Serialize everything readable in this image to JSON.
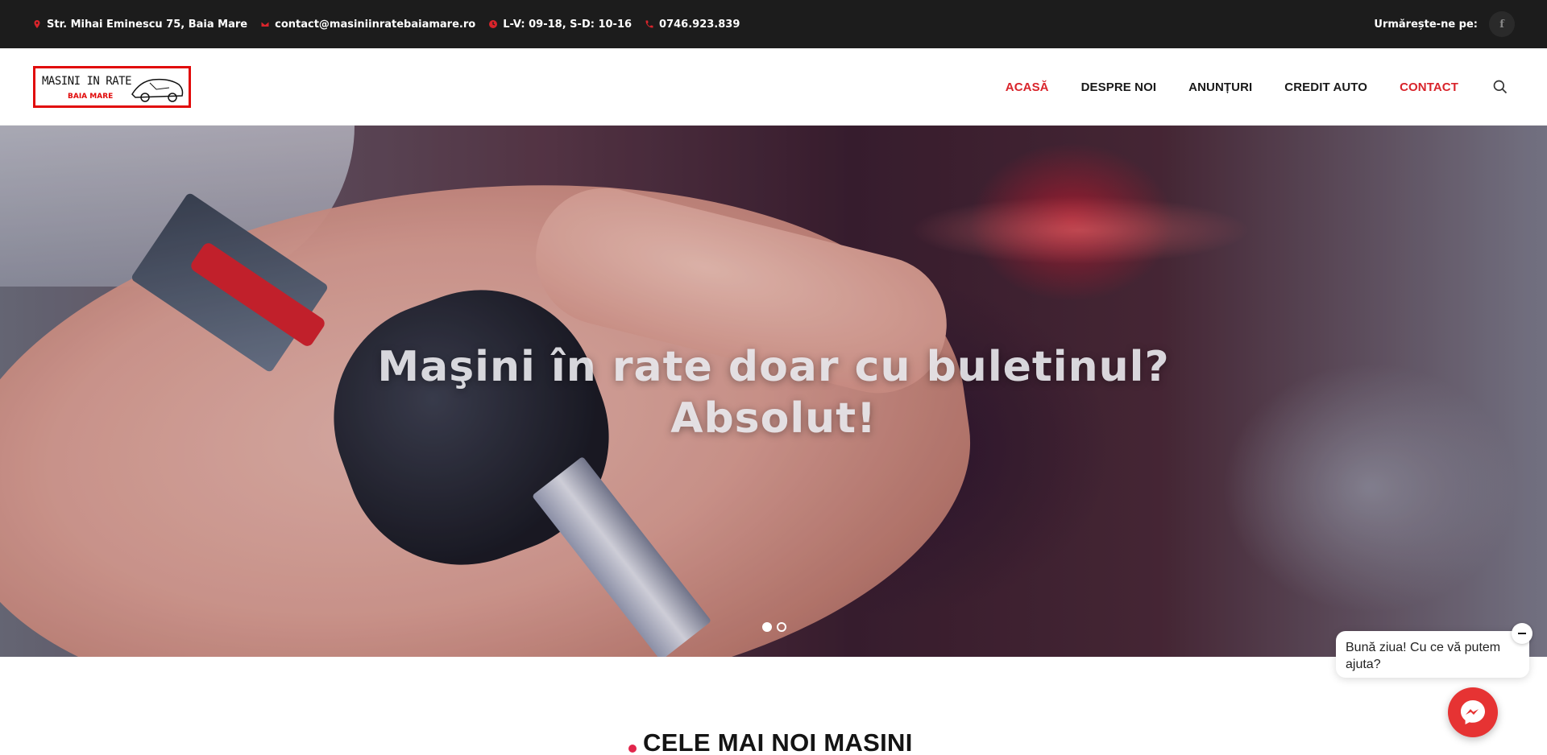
{
  "topbar": {
    "address": "Str. Mihai Eminescu 75, Baia Mare",
    "email": "contact@masiniinratebaiamare.ro",
    "hours": "L-V: 09-18, S-D: 10-16",
    "phone": "0746.923.839",
    "follow_label": "Urmărește-ne pe:",
    "facebook_glyph": "f"
  },
  "logo": {
    "line1": "MASINI IN RATE",
    "line2": "BAIA MARE"
  },
  "nav": {
    "items": [
      {
        "label": "ACASĂ"
      },
      {
        "label": "DESPRE NOI"
      },
      {
        "label": "ANUNȚURI"
      },
      {
        "label": "CREDIT AUTO"
      },
      {
        "label": "CONTACT"
      }
    ],
    "accent_color": "#d9242b"
  },
  "hero": {
    "title_line1": "Maşini în rate doar cu buletinul?",
    "title_line2": "Absolut!",
    "slides_total": 2,
    "active_slide": 1
  },
  "section": {
    "title": "CELE MAI NOI MASINI"
  },
  "chat": {
    "message": "Bună ziua! Cu ce vă putem ajuta?",
    "button_color": "#e63333"
  },
  "icons": [
    "map-marker-icon",
    "envelope-icon",
    "clock-icon",
    "phone-icon",
    "facebook-icon",
    "search-icon",
    "messenger-icon",
    "minus-icon"
  ]
}
